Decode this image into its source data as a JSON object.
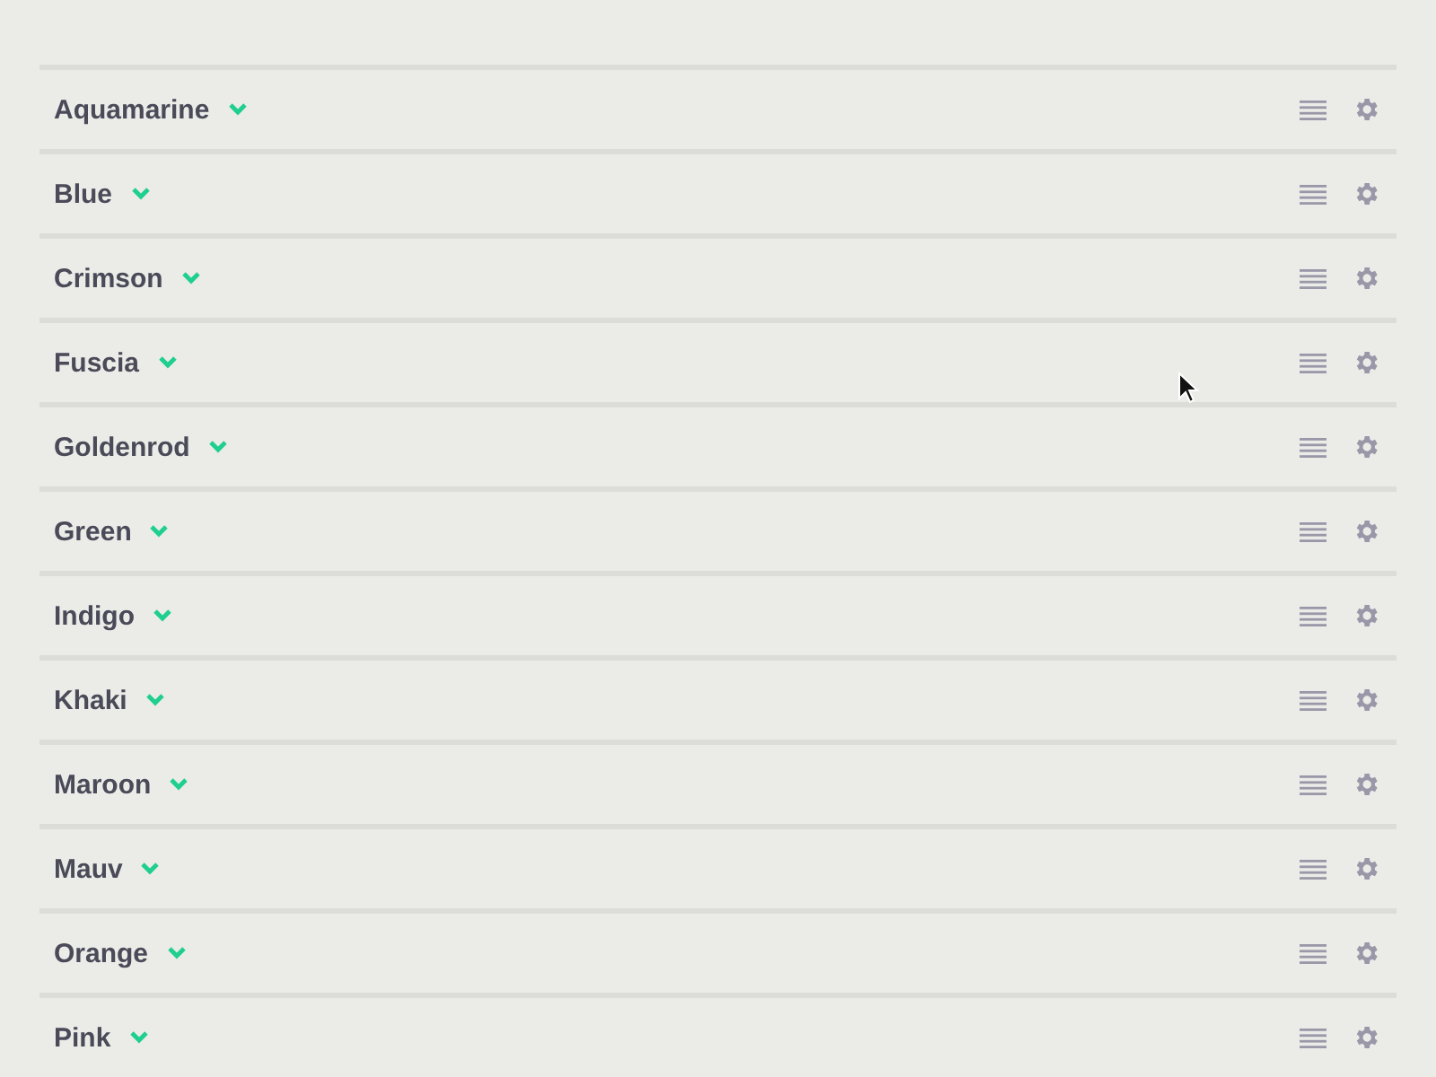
{
  "rows": [
    {
      "name": "Aquamarine",
      "expanded": false
    },
    {
      "name": "Blue",
      "expanded": false
    },
    {
      "name": "Crimson",
      "expanded": false
    },
    {
      "name": "Fuscia",
      "expanded": false
    },
    {
      "name": "Goldenrod",
      "expanded": false
    },
    {
      "name": "Green",
      "expanded": false
    },
    {
      "name": "Indigo",
      "expanded": false
    },
    {
      "name": "Khaki",
      "expanded": false
    },
    {
      "name": "Maroon",
      "expanded": false
    },
    {
      "name": "Mauv",
      "expanded": false
    },
    {
      "name": "Orange",
      "expanded": false
    },
    {
      "name": "Pink",
      "expanded": false
    }
  ]
}
